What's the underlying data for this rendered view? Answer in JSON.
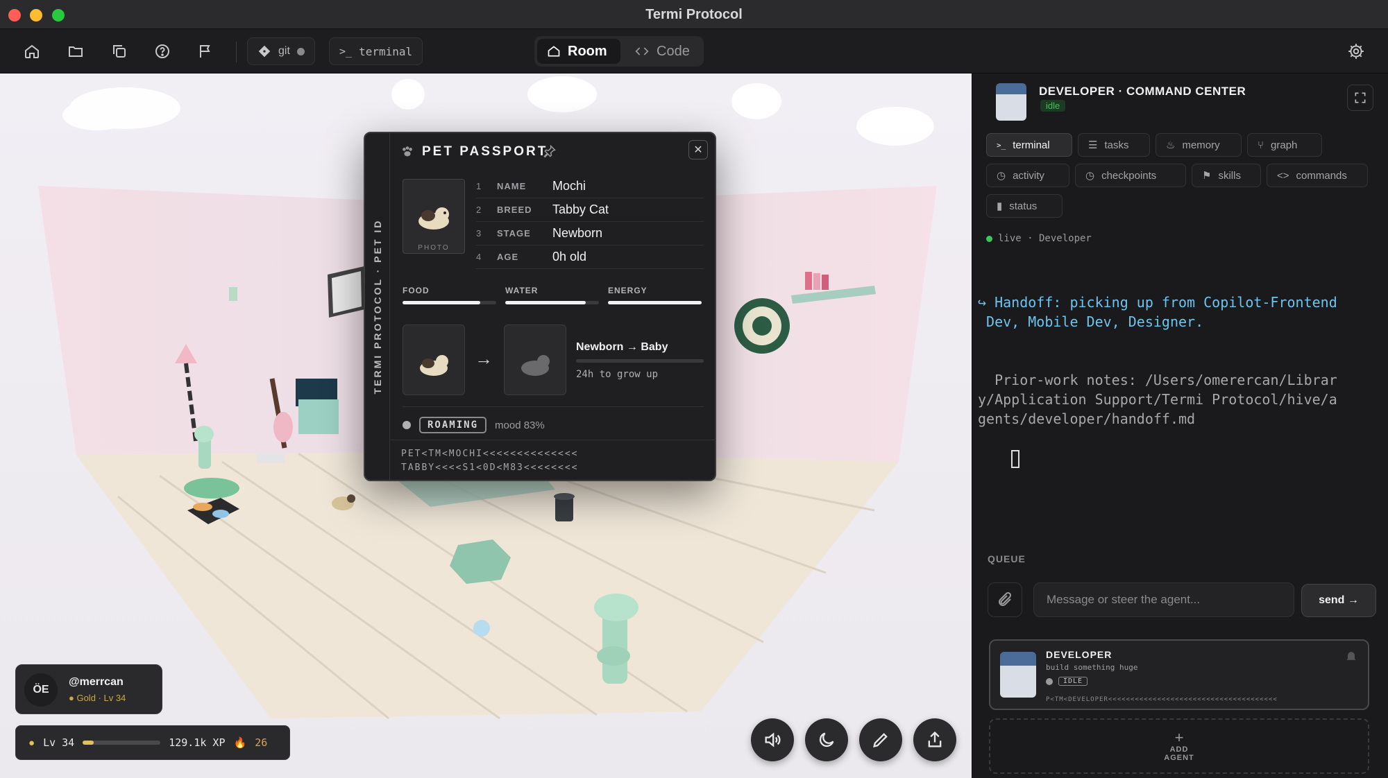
{
  "window": {
    "title": "Termi Protocol"
  },
  "toolbar": {
    "git_label": "git",
    "terminal_label": "terminal",
    "room_label": "Room",
    "code_label": "Code"
  },
  "passport": {
    "title": "PET PASSPORT",
    "spine": "TERMI PROTOCOL · PET ID",
    "photo_label": "PHOTO",
    "fields": [
      {
        "num": "1",
        "key": "NAME",
        "value": "Mochi"
      },
      {
        "num": "2",
        "key": "BREED",
        "value": "Tabby Cat"
      },
      {
        "num": "3",
        "key": "STAGE",
        "value": "Newborn"
      },
      {
        "num": "4",
        "key": "AGE",
        "value": "0h old"
      }
    ],
    "stats": [
      {
        "label": "FOOD",
        "level": 0.83
      },
      {
        "label": "WATER",
        "level": 0.86
      },
      {
        "label": "ENERGY",
        "level": 1.0
      }
    ],
    "evolution": {
      "title": "Newborn → Baby",
      "subtitle": "24h to grow up",
      "progress": 0
    },
    "status": "ROAMING",
    "mood": "mood 83%",
    "mrz_line1": "PET<TM<MOCHI<<<<<<<<<<<<<<",
    "mrz_line2": "TABBY<<<<S1<0D<M83<<<<<<<<"
  },
  "hud": {
    "avatar_initials": "ÖE",
    "handle": "@merrcan",
    "rank": "Gold · Lv 34",
    "level": "Lv 34",
    "xp_progress": 0.14,
    "xp": "129.1k XP",
    "streak": "26"
  },
  "panel": {
    "title": "DEVELOPER · COMMAND CENTER",
    "state": "idle",
    "tabs": [
      {
        "label": "terminal",
        "icon": "terminal-icon"
      },
      {
        "label": "tasks",
        "icon": "list-icon"
      },
      {
        "label": "memory",
        "icon": "flame-icon"
      },
      {
        "label": "graph",
        "icon": "graph-icon"
      },
      {
        "label": "activity",
        "icon": "clock-icon"
      },
      {
        "label": "checkpoints",
        "icon": "clock-icon"
      },
      {
        "label": "skills",
        "icon": "bookmark-icon"
      },
      {
        "label": "commands",
        "icon": "code-icon"
      },
      {
        "label": "status",
        "icon": "bar-chart-icon"
      }
    ],
    "live_text": "live · Developer",
    "term_handoff": "↪ Handoff: picking up from Copilot-Frontend\n Dev, Mobile Dev, Designer.",
    "term_notes": "  Prior-work notes: /Users/omerercan/Librar\ny/Application Support/Termi Protocol/hive/a\ngents/developer/handoff.md",
    "queue_label": "QUEUE",
    "input_placeholder": "Message or steer the agent...",
    "send_label": "send →",
    "agent": {
      "name": "DEVELOPER",
      "subtitle": "build something huge",
      "status": "IDLE",
      "mrz": "P<TM<DEVELOPER<<<<<<<<<<<<<<<<<<<<<<<<<<<<<<<<<<<<<<"
    },
    "add_plus": "+",
    "add_label_1": "ADD",
    "add_label_2": "AGENT"
  }
}
